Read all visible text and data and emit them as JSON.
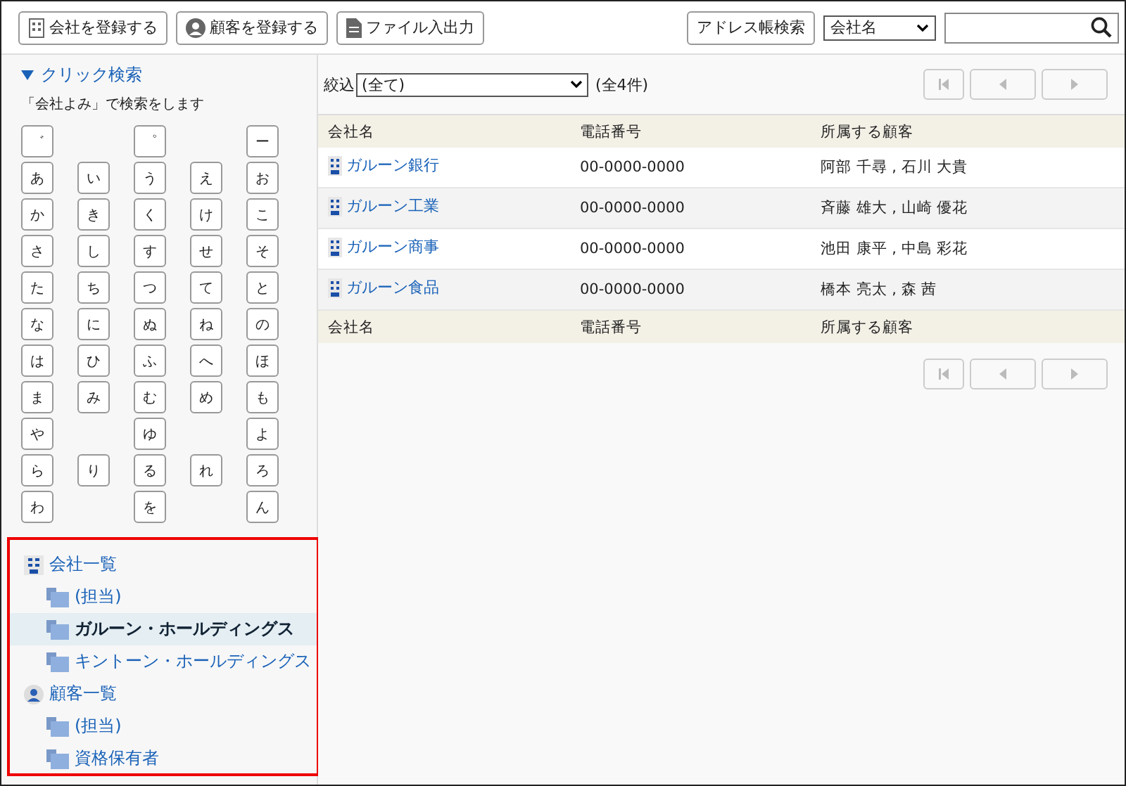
{
  "toolbar": {
    "buttons": [
      {
        "label": "会社を登録する",
        "kind": "company"
      },
      {
        "label": "顧客を登録する",
        "kind": "person"
      },
      {
        "label": "ファイル入出力",
        "kind": "file"
      }
    ],
    "search_button": "アドレス帳検索",
    "search_scope": "会社名"
  },
  "click_search": {
    "title": "クリック検索",
    "expanded": true,
    "hint": "「会社よみ」で検索をします",
    "rows": [
      [
        "゛",
        null,
        "゜",
        null,
        "ー"
      ],
      [
        "あ",
        "い",
        "う",
        "え",
        "お"
      ],
      [
        "か",
        "き",
        "く",
        "け",
        "こ"
      ],
      [
        "さ",
        "し",
        "す",
        "せ",
        "そ"
      ],
      [
        "た",
        "ち",
        "つ",
        "て",
        "と"
      ],
      [
        "な",
        "に",
        "ぬ",
        "ね",
        "の"
      ],
      [
        "は",
        "ひ",
        "ふ",
        "へ",
        "ほ"
      ],
      [
        "ま",
        "み",
        "む",
        "め",
        "も"
      ],
      [
        "や",
        null,
        "ゆ",
        null,
        "よ"
      ],
      [
        "ら",
        "り",
        "る",
        "れ",
        "ろ"
      ],
      [
        "わ",
        null,
        "を",
        null,
        "ん"
      ]
    ]
  },
  "tree": [
    {
      "label": "会社一覧",
      "kind": "company",
      "selected": false,
      "children": [
        {
          "label": "(担当)",
          "kind": "folder",
          "selected": false
        },
        {
          "label": "ガルーン・ホールディングス",
          "kind": "folder",
          "selected": true
        },
        {
          "label": "キントーン・ホールディングス",
          "kind": "folder",
          "selected": false
        }
      ]
    },
    {
      "label": "顧客一覧",
      "kind": "person",
      "selected": false,
      "children": [
        {
          "label": "(担当)",
          "kind": "folder",
          "selected": false
        },
        {
          "label": "資格保有者",
          "kind": "folder",
          "selected": false
        }
      ]
    }
  ],
  "filter": {
    "label": "絞込",
    "value": "(全て)",
    "count": "(全4件)"
  },
  "table": {
    "columns": [
      "会社名",
      "電話番号",
      "所属する顧客"
    ],
    "rows": [
      [
        "ガルーン銀行",
        "00-0000-0000",
        "阿部 千尋 , 石川 大貴"
      ],
      [
        "ガルーン工業",
        "00-0000-0000",
        "斉藤 雄大 , 山崎 優花"
      ],
      [
        "ガルーン商事",
        "00-0000-0000",
        "池田 康平 , 中島 彩花"
      ],
      [
        "ガルーン食品",
        "00-0000-0000",
        "橋本 亮太 , 森 茜"
      ]
    ],
    "footer_columns": [
      "会社名",
      "電話番号",
      "所属する顧客"
    ]
  }
}
